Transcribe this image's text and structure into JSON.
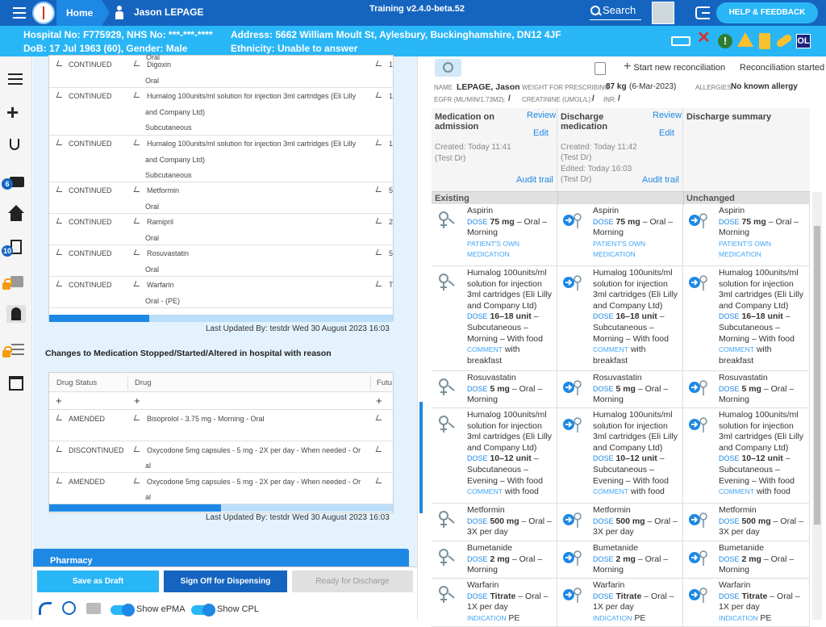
{
  "topbar": {
    "home": "Home",
    "patient_name": "Jason LEPAGE",
    "training": "Training v2.4.0-beta.52",
    "search": "Search",
    "help": "HELP & FEEDBACK"
  },
  "patient": {
    "hospital": "Hospital No: F775929, NHS No: ***-***-****",
    "address": "Address: 5662 William Moult St, Aylesbury, Buckinghamshire, DN12 4JF",
    "dob": "DoB: 17 Jul 1963 (60), Gender: Male",
    "ethnicity": "Ethnicity: Unable to answer",
    "initials": "OL"
  },
  "sidebar": {
    "badge1": "6",
    "badge2": "10"
  },
  "left": {
    "top_rows": [
      {
        "status": "CONTINUED",
        "drug": "Digoxin",
        "route": "Oral",
        "future": "1"
      },
      {
        "status": "CONTINUED",
        "drug": "Humalog 100units/ml solution for injection 3ml cartridges (Eli Lilly",
        "drug2": "and Company Ltd)",
        "route": "Subcutaneous",
        "future": "1"
      },
      {
        "status": "CONTINUED",
        "drug": "Humalog 100units/ml solution for injection 3ml cartridges (Eli Lilly",
        "drug2": "and Company Ltd)",
        "route": "Subcutaneous",
        "future": "1"
      },
      {
        "status": "CONTINUED",
        "drug": "Metformin",
        "route": "Oral",
        "future": "5"
      },
      {
        "status": "CONTINUED",
        "drug": "Ramipril",
        "route": "Oral",
        "future": "2"
      },
      {
        "status": "CONTINUED",
        "drug": "Rosuvastatin",
        "route": "Oral",
        "future": "5"
      },
      {
        "status": "CONTINUED",
        "drug": "Warfarin",
        "route": "Oral - (PE)",
        "future": "T"
      }
    ],
    "top_scroll_fraction": 0.29,
    "last_updated_1": "Last Updated By: testdr Wed 30 August 2023 16:03",
    "section_title": "Changes to Medication Stopped/Started/Altered in hospital with reason",
    "headers": {
      "status": "Drug Status",
      "drug": "Drug",
      "future": "Futu"
    },
    "add_symbol": "+",
    "changes": [
      {
        "status": "AMENDED",
        "drug": "Bisoprolol - 3.75 mg - Morning - Oral",
        "drug2": ""
      },
      {
        "status": "DISCONTINUED",
        "drug": "Oxycodone 5mg capsules - 5 mg - 2X per day - When needed - Or",
        "drug2": "al"
      },
      {
        "status": "AMENDED",
        "drug": "Oxycodone 5mg capsules - 5 mg - 2X per day - When needed - Or",
        "drug2": "al"
      }
    ],
    "bottom_scroll_fraction": 0.5,
    "last_updated_2": "Last Updated By: testdr Wed 30 August 2023 16:03",
    "pharmacy": "Pharmacy",
    "buttons": {
      "draft": "Save as Draft",
      "signoff": "Sign Off for Dispensing",
      "ready": "Ready for Discharge"
    },
    "toggles": {
      "epma": "Show ePMA",
      "cpl": "Show CPL"
    }
  },
  "right": {
    "toolbar": {
      "new_rec": "Start new reconciliation",
      "started": "Reconciliation started"
    },
    "pt": {
      "name_lbl": "NAME",
      "name": "LEPAGE, Jason",
      "weight_lbl": "WEIGHT FOR PRESCRIBING:",
      "weight": "87 kg",
      "weight_date": "(6-Mar-2023)",
      "allergy_lbl": "ALLERGIES:",
      "allergy": "No known allergy",
      "egfr_lbl": "EGFR (ML/MIN/1.73M2):",
      "egfr": "/",
      "creat_lbl": "CREATININE (UMOL/L):",
      "creat": "/",
      "inr_lbl": "INR:",
      "inr": "/"
    },
    "columns": [
      {
        "title": "Medication on admission",
        "review": "Review",
        "edit": "Edit",
        "created": "Created: Today 11:41",
        "by": "(Test Dr)",
        "edited": "",
        "by2": "",
        "audit": "Audit trail"
      },
      {
        "title": "Discharge medication",
        "review": "Review",
        "edit": "Edit",
        "created": "Created: Today 11:42",
        "by": "(Test Dr)",
        "edited": "Edited: Today 16:03",
        "by2": "(Test Dr)",
        "audit": "Audit trail"
      },
      {
        "title": "Discharge summary"
      }
    ],
    "group_headers": [
      "Existing",
      "",
      "Unchanged"
    ],
    "meds": [
      {
        "name": [
          "Aspirin"
        ],
        "dose_lbl": "DOSE",
        "dose": "75 mg",
        "rest": [
          "– Oral –",
          "Morning"
        ],
        "extra": [
          "PATIENT'S OWN",
          "MEDICATION"
        ]
      },
      {
        "name": [
          "Humalog 100units/ml",
          "solution for injection",
          "3ml cartridges (Eli Lilly",
          "and Company Ltd)"
        ],
        "dose_lbl": "DOSE",
        "dose": "16–18 unit",
        "rest": [
          "–",
          "Subcutaneous –",
          "Morning – With food"
        ],
        "comment_lbl": "COMMENT",
        "comment": [
          "with",
          "breakfast"
        ]
      },
      {
        "name": [
          "Rosuvastatin"
        ],
        "dose_lbl": "DOSE",
        "dose": "5 mg",
        "rest": [
          "– Oral –",
          "Morning"
        ]
      },
      {
        "name": [
          "Humalog 100units/ml",
          "solution for injection",
          "3ml cartridges (Eli Lilly",
          "and Company Ltd)"
        ],
        "dose_lbl": "DOSE",
        "dose": "10–12 unit",
        "rest": [
          "–",
          "Subcutaneous –",
          "Evening – With food"
        ],
        "comment_lbl": "COMMENT",
        "comment": [
          "with food"
        ]
      },
      {
        "name": [
          "Metformin"
        ],
        "dose_lbl": "DOSE",
        "dose": "500 mg",
        "rest": [
          "– Oral –",
          "3X per day"
        ]
      },
      {
        "name": [
          "Bumetanide"
        ],
        "dose_lbl": "DOSE",
        "dose": "2 mg",
        "rest": [
          "– Oral –",
          "Morning"
        ]
      },
      {
        "name": [
          "Warfarin"
        ],
        "dose_lbl": "DOSE",
        "dose": "Titrate",
        "rest": [
          "– Oral –",
          "1X per day"
        ],
        "ind_lbl": "INDICATION",
        "ind": "PE"
      }
    ]
  }
}
